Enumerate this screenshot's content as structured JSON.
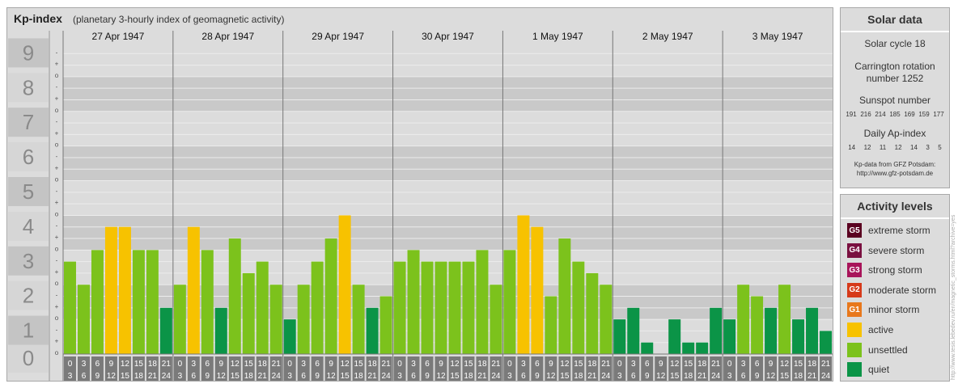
{
  "header": {
    "title": "Kp-index",
    "subtitle": "(planetary 3-hourly index of geomagnetic activity)"
  },
  "chart_data": {
    "type": "bar",
    "title": "Kp-index",
    "subtitle": "(planetary 3-hourly index of geomagnetic activity)",
    "ylim": [
      0,
      9
    ],
    "y_ticks": [
      "0",
      "1",
      "2",
      "3",
      "4",
      "5",
      "6",
      "7",
      "8",
      "9"
    ],
    "minor_tick_marks": [
      "o",
      "+",
      "-"
    ],
    "days": [
      "27 Apr 1947",
      "28 Apr 1947",
      "29 Apr 1947",
      "30 Apr 1947",
      "1 May 1947",
      "2 May 1947",
      "3 May 1947"
    ],
    "hour_ranges": [
      [
        "0",
        "3"
      ],
      [
        "3",
        "6"
      ],
      [
        "6",
        "9"
      ],
      [
        "9",
        "12"
      ],
      [
        "12",
        "15"
      ],
      [
        "15",
        "18"
      ],
      [
        "18",
        "21"
      ],
      [
        "21",
        "24"
      ]
    ],
    "values": [
      [
        2.667,
        2.0,
        3.0,
        3.667,
        3.667,
        3.0,
        3.0,
        1.333
      ],
      [
        2.0,
        3.667,
        3.0,
        1.333,
        3.333,
        2.333,
        2.667,
        2.0
      ],
      [
        1.0,
        2.0,
        2.667,
        3.333,
        4.0,
        2.0,
        1.333,
        1.667
      ],
      [
        2.667,
        3.0,
        2.667,
        2.667,
        2.667,
        2.667,
        3.0,
        2.0
      ],
      [
        3.0,
        4.0,
        3.667,
        1.667,
        3.333,
        2.667,
        2.333,
        2.0
      ],
      [
        1.0,
        1.333,
        0.333,
        0.0,
        1.0,
        0.333,
        0.333,
        1.333
      ],
      [
        1.0,
        2.0,
        1.667,
        1.333,
        2.0,
        1.0,
        1.333,
        0.667
      ]
    ],
    "grid": true
  },
  "solar_data": {
    "title": "Solar data",
    "solar_cycle": "Solar cycle 18",
    "carrington_1": "Carrington rotation",
    "carrington_2": "number 1252",
    "sunspot_title": "Sunspot number",
    "sunspot_numbers": [
      "191",
      "216",
      "214",
      "185",
      "169",
      "159",
      "177"
    ],
    "ap_title": "Daily Ap-index",
    "ap_numbers": [
      "14",
      "12",
      "11",
      "12",
      "14",
      "3",
      "5"
    ],
    "source_1": "Kp-data from  GFZ Potsdam:",
    "source_2": "http://www.gfz-potsdam.de"
  },
  "activity_levels": {
    "title": "Activity levels",
    "items": [
      {
        "badge": "G5",
        "label": "extreme storm",
        "color": "#5a0020"
      },
      {
        "badge": "G4",
        "label": "severe storm",
        "color": "#7a1040"
      },
      {
        "badge": "G3",
        "label": "strong storm",
        "color": "#a8145a"
      },
      {
        "badge": "G2",
        "label": "moderate storm",
        "color": "#d63a1a"
      },
      {
        "badge": "G1",
        "label": "minor storm",
        "color": "#e8781c"
      },
      {
        "badge": "",
        "label": "active",
        "color": "#f7c200"
      },
      {
        "badge": "",
        "label": "unsettled",
        "color": "#7cc21c"
      },
      {
        "badge": "",
        "label": "quiet",
        "color": "#0b9447"
      }
    ]
  },
  "watermark": "http://www.tesis.lebedev.ru/en/magnetic_storms.html?archive=yes"
}
